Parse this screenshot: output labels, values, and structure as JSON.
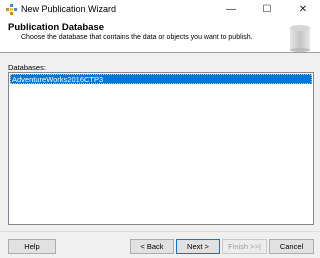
{
  "window": {
    "title": "New Publication Wizard",
    "minimize_glyph": "—",
    "maximize_glyph": "☐",
    "close_glyph": "✕",
    "app_icon": "wizard-icon"
  },
  "header": {
    "title": "Publication Database",
    "subtitle": "Choose the database that contains the data or objects you want to publish.",
    "graphic": "publication-database-graphic"
  },
  "databases": {
    "label": "Databases:",
    "items": [
      "AdventureWorks2016CTP3"
    ],
    "selected": "AdventureWorks2016CTP3"
  },
  "buttons": {
    "help": "Help",
    "back": "< Back",
    "next": "Next >",
    "finish": "Finish >>|",
    "cancel": "Cancel"
  },
  "colors": {
    "selection": "#0078d7",
    "dialog_bg": "#f0f0f0"
  }
}
